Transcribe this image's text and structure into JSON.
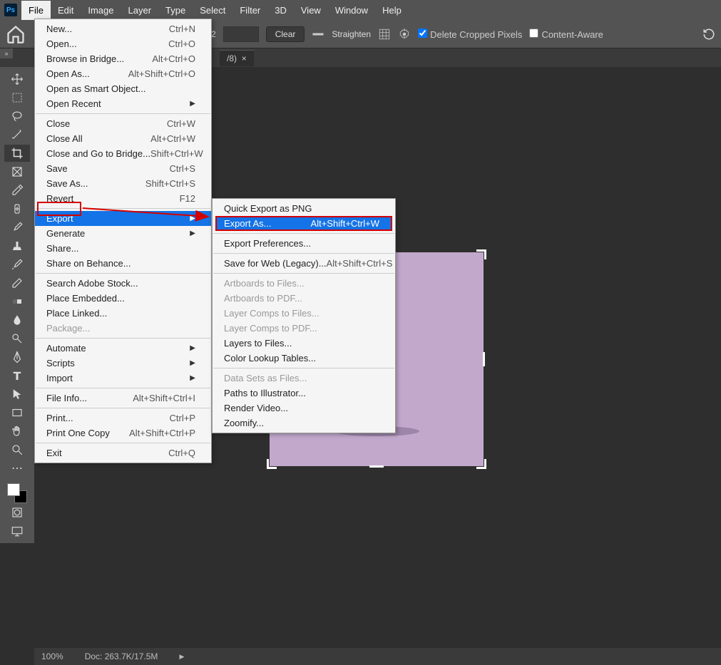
{
  "app": {
    "logo": "Ps"
  },
  "menus": [
    "File",
    "Edit",
    "Image",
    "Layer",
    "Type",
    "Select",
    "Filter",
    "3D",
    "View",
    "Window",
    "Help"
  ],
  "activeMenu": "File",
  "options": {
    "val2_label": "2",
    "clear": "Clear",
    "straighten": "Straighten",
    "deleteCropped": "Delete Cropped Pixels",
    "contentAware": "Content-Aware"
  },
  "tab": {
    "label": "/8)",
    "close": "×"
  },
  "fileMenu": [
    {
      "t": "row",
      "label": "New...",
      "sc": "Ctrl+N"
    },
    {
      "t": "row",
      "label": "Open...",
      "sc": "Ctrl+O"
    },
    {
      "t": "row",
      "label": "Browse in Bridge...",
      "sc": "Alt+Ctrl+O"
    },
    {
      "t": "row",
      "label": "Open As...",
      "sc": "Alt+Shift+Ctrl+O"
    },
    {
      "t": "row",
      "label": "Open as Smart Object..."
    },
    {
      "t": "row",
      "label": "Open Recent",
      "sub": true
    },
    {
      "t": "sep"
    },
    {
      "t": "row",
      "label": "Close",
      "sc": "Ctrl+W"
    },
    {
      "t": "row",
      "label": "Close All",
      "sc": "Alt+Ctrl+W"
    },
    {
      "t": "row",
      "label": "Close and Go to Bridge...",
      "sc": "Shift+Ctrl+W"
    },
    {
      "t": "row",
      "label": "Save",
      "sc": "Ctrl+S"
    },
    {
      "t": "row",
      "label": "Save As...",
      "sc": "Shift+Ctrl+S"
    },
    {
      "t": "row",
      "label": "Revert",
      "sc": "F12"
    },
    {
      "t": "sep"
    },
    {
      "t": "row",
      "label": "Export",
      "sub": true,
      "hl": true,
      "redbox": true
    },
    {
      "t": "row",
      "label": "Generate",
      "sub": true
    },
    {
      "t": "row",
      "label": "Share..."
    },
    {
      "t": "row",
      "label": "Share on Behance..."
    },
    {
      "t": "sep"
    },
    {
      "t": "row",
      "label": "Search Adobe Stock..."
    },
    {
      "t": "row",
      "label": "Place Embedded..."
    },
    {
      "t": "row",
      "label": "Place Linked..."
    },
    {
      "t": "row",
      "label": "Package...",
      "disabled": true
    },
    {
      "t": "sep"
    },
    {
      "t": "row",
      "label": "Automate",
      "sub": true
    },
    {
      "t": "row",
      "label": "Scripts",
      "sub": true
    },
    {
      "t": "row",
      "label": "Import",
      "sub": true
    },
    {
      "t": "sep"
    },
    {
      "t": "row",
      "label": "File Info...",
      "sc": "Alt+Shift+Ctrl+I"
    },
    {
      "t": "sep"
    },
    {
      "t": "row",
      "label": "Print...",
      "sc": "Ctrl+P"
    },
    {
      "t": "row",
      "label": "Print One Copy",
      "sc": "Alt+Shift+Ctrl+P"
    },
    {
      "t": "sep"
    },
    {
      "t": "row",
      "label": "Exit",
      "sc": "Ctrl+Q"
    }
  ],
  "exportMenu": [
    {
      "t": "row",
      "label": "Quick Export as PNG"
    },
    {
      "t": "row",
      "label": "Export As...",
      "sc": "Alt+Shift+Ctrl+W",
      "hlExport": true
    },
    {
      "t": "sep"
    },
    {
      "t": "row",
      "label": "Export Preferences..."
    },
    {
      "t": "sep"
    },
    {
      "t": "row",
      "label": "Save for Web (Legacy)...",
      "sc": "Alt+Shift+Ctrl+S"
    },
    {
      "t": "sep"
    },
    {
      "t": "row",
      "label": "Artboards to Files...",
      "disabled": true
    },
    {
      "t": "row",
      "label": "Artboards to PDF...",
      "disabled": true
    },
    {
      "t": "row",
      "label": "Layer Comps to Files...",
      "disabled": true
    },
    {
      "t": "row",
      "label": "Layer Comps to PDF...",
      "disabled": true
    },
    {
      "t": "row",
      "label": "Layers to Files..."
    },
    {
      "t": "row",
      "label": "Color Lookup Tables..."
    },
    {
      "t": "sep"
    },
    {
      "t": "row",
      "label": "Data Sets as Files...",
      "disabled": true
    },
    {
      "t": "row",
      "label": "Paths to Illustrator..."
    },
    {
      "t": "row",
      "label": "Render Video..."
    },
    {
      "t": "row",
      "label": "Zoomify..."
    }
  ],
  "status": {
    "zoom": "100%",
    "doc": "Doc: 263.7K/17.5M",
    "arrow": "▶"
  }
}
